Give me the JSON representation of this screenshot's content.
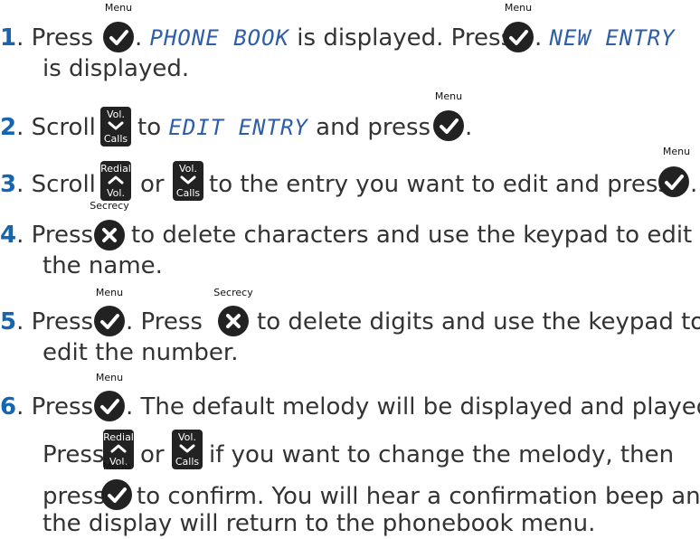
{
  "keys": {
    "menu_label": "Menu",
    "secrecy_label": "Secrecy",
    "redial_top": "Redial",
    "redial_bottom": "Vol.",
    "vol_top": "Vol.",
    "vol_bottom": "Calls",
    "icons": {
      "menu": "check-icon",
      "secrecy": "x-icon",
      "up": "chevron-up-icon",
      "down": "chevron-down-icon"
    }
  },
  "colors": {
    "step_number": "#1565b0",
    "display_text": "#2f5ea8",
    "key": "#222222"
  },
  "steps": [
    {
      "num": "1",
      "a": ". Press",
      "b": ".",
      "display1": "PHONE BOOK",
      "c": "is displayed. Press",
      "d": ".",
      "display2": "NEW ENTRY",
      "line2": "is displayed."
    },
    {
      "num": "2",
      "a": ". Scroll",
      "b": "to",
      "display": "EDIT ENTRY",
      "c": "and press",
      "d": "."
    },
    {
      "num": "3",
      "a": ". Scroll",
      "b": "or",
      "c": "to the entry you want to edit and press",
      "d": "."
    },
    {
      "num": "4",
      "a": ". Press",
      "b": "to delete characters and use the keypad to edit",
      "line2": "the name."
    },
    {
      "num": "5",
      "a": ". Press",
      "b": ". Press",
      "c": "to delete digits and use the keypad to",
      "line2": "edit the number."
    },
    {
      "num": "6",
      "a": ". Press",
      "b": ". The default melody will be displayed and played.",
      "line2a": "Press",
      "line2b": "or",
      "line2c": "if you want to change the melody, then",
      "line3a": "press",
      "line3b": "to confirm. You will hear a confirmation beep and",
      "line4": "the display will return to the phonebook menu."
    }
  ]
}
